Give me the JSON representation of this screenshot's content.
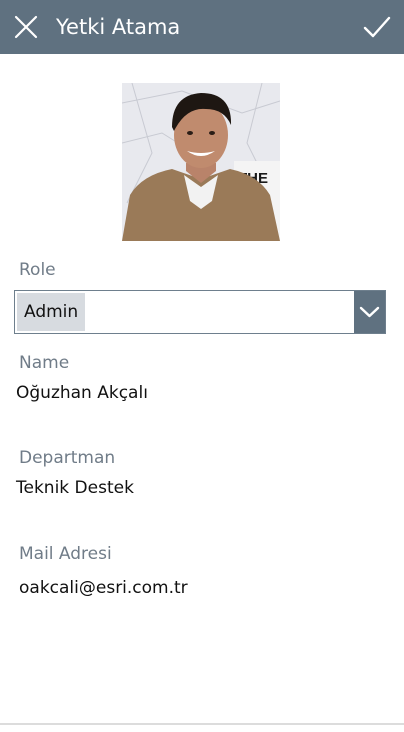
{
  "header": {
    "title": "Yetki Atama",
    "close_icon": "close-icon",
    "confirm_icon": "checkmark-icon",
    "background": "#5f7180"
  },
  "profile": {
    "photo": "profile-photo"
  },
  "role": {
    "label": "Role",
    "selected": "Admin",
    "dropdown_icon": "chevron-down-icon"
  },
  "name": {
    "label": "Name",
    "value": "Oğuzhan Akçalı"
  },
  "department": {
    "label": "Departman",
    "value": "Teknik Destek"
  },
  "mail": {
    "label": "Mail Adresi",
    "value": "oakcali@esri.com.tr"
  }
}
